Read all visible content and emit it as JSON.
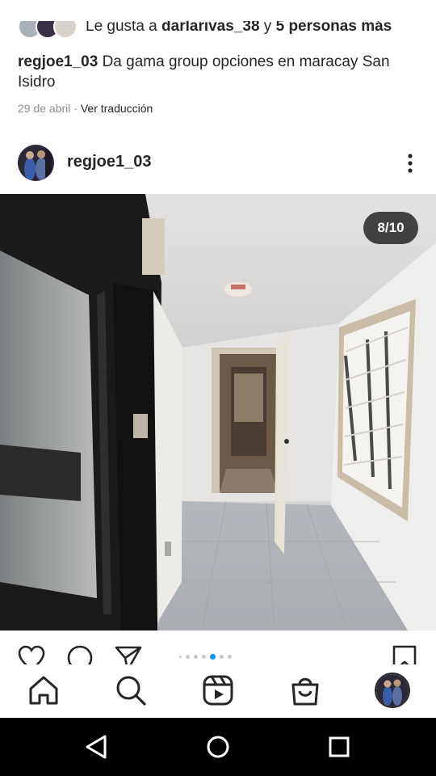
{
  "likes": {
    "prefix": "Le gusta a ",
    "user": "darlarivas_38",
    "middle": " y ",
    "others": "5 personas más"
  },
  "caption": {
    "username": "regjoe1_03",
    "text": " Da gama group opciones en maracay San Isidro"
  },
  "meta": {
    "date": "29 de abril",
    "separator": " · ",
    "translate_label": "Ver traducción"
  },
  "post": {
    "username": "regjoe1_03",
    "more_icon": "more-vertical-icon",
    "counter": "8/10",
    "carousel_total": 10,
    "carousel_index": 8
  },
  "actions": {
    "like_icon": "heart-icon",
    "comment_icon": "comment-icon",
    "share_icon": "send-icon",
    "save_icon": "bookmark-icon"
  },
  "bottom_nav": [
    "home-icon",
    "search-icon",
    "reels-icon",
    "shop-icon",
    "profile-avatar"
  ],
  "system_nav": [
    "back-icon",
    "home-circle-icon",
    "recents-icon"
  ],
  "colors": {
    "accent": "#0095f6",
    "text": "#262626",
    "muted": "#8e8e8e"
  }
}
